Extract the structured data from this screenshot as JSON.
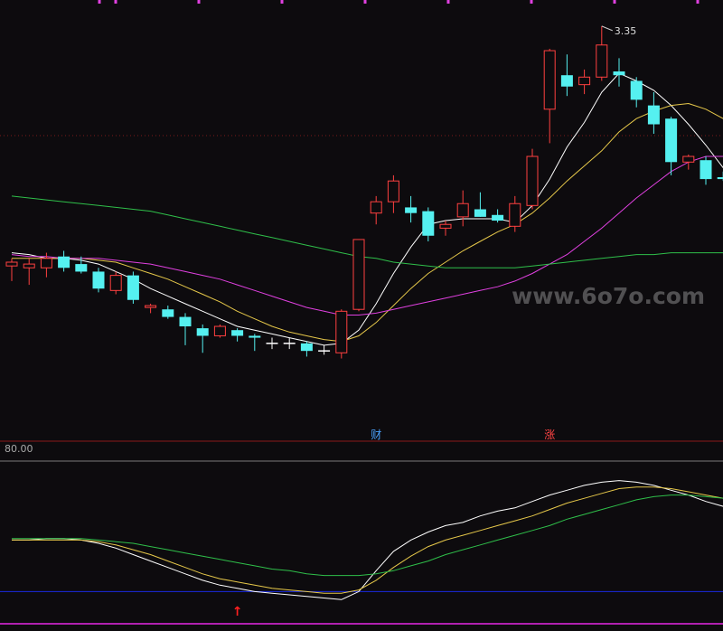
{
  "chart_data": [
    {
      "type": "candlestick",
      "title": "",
      "price_panel_ylim": [
        1.2,
        3.45
      ],
      "max_price_label": "3.35",
      "markers": [
        {
          "text": "财",
          "index": 21,
          "color": "#4aa3ff"
        },
        {
          "text": "涨",
          "index": 31,
          "color": "#ff4444"
        }
      ],
      "candles": [
        {
          "o": 2.08,
          "h": 2.12,
          "l": 2.0,
          "c": 2.1
        },
        {
          "o": 2.07,
          "h": 2.12,
          "l": 1.98,
          "c": 2.09
        },
        {
          "o": 2.07,
          "h": 2.15,
          "l": 2.02,
          "c": 2.12
        },
        {
          "o": 2.13,
          "h": 2.16,
          "l": 2.05,
          "c": 2.07
        },
        {
          "o": 2.09,
          "h": 2.13,
          "l": 2.04,
          "c": 2.05
        },
        {
          "o": 2.05,
          "h": 2.07,
          "l": 1.94,
          "c": 1.96
        },
        {
          "o": 1.95,
          "h": 2.05,
          "l": 1.93,
          "c": 2.03
        },
        {
          "o": 2.03,
          "h": 2.05,
          "l": 1.88,
          "c": 1.9
        },
        {
          "o": 1.86,
          "h": 1.88,
          "l": 1.83,
          "c": 1.87
        },
        {
          "o": 1.85,
          "h": 1.87,
          "l": 1.8,
          "c": 1.81
        },
        {
          "o": 1.81,
          "h": 1.83,
          "l": 1.66,
          "c": 1.76
        },
        {
          "o": 1.75,
          "h": 1.77,
          "l": 1.62,
          "c": 1.71
        },
        {
          "o": 1.71,
          "h": 1.77,
          "l": 1.7,
          "c": 1.76
        },
        {
          "o": 1.74,
          "h": 1.75,
          "l": 1.68,
          "c": 1.71
        },
        {
          "o": 1.71,
          "h": 1.72,
          "l": 1.63,
          "c": 1.7
        },
        {
          "o": 1.67,
          "h": 1.7,
          "l": 1.64,
          "c": 1.67
        },
        {
          "o": 1.67,
          "h": 1.7,
          "l": 1.64,
          "c": 1.67
        },
        {
          "o": 1.67,
          "h": 1.68,
          "l": 1.6,
          "c": 1.63
        },
        {
          "o": 1.63,
          "h": 1.66,
          "l": 1.61,
          "c": 1.63
        },
        {
          "o": 1.62,
          "h": 1.85,
          "l": 1.59,
          "c": 1.84
        },
        {
          "o": 1.85,
          "h": 2.22,
          "l": 1.84,
          "c": 2.22
        },
        {
          "o": 2.36,
          "h": 2.45,
          "l": 2.3,
          "c": 2.42
        },
        {
          "o": 2.42,
          "h": 2.56,
          "l": 2.36,
          "c": 2.53
        },
        {
          "o": 2.39,
          "h": 2.45,
          "l": 2.31,
          "c": 2.36
        },
        {
          "o": 2.37,
          "h": 2.39,
          "l": 2.21,
          "c": 2.24
        },
        {
          "o": 2.28,
          "h": 2.32,
          "l": 2.24,
          "c": 2.3
        },
        {
          "o": 2.34,
          "h": 2.48,
          "l": 2.29,
          "c": 2.41
        },
        {
          "o": 2.38,
          "h": 2.47,
          "l": 2.34,
          "c": 2.34
        },
        {
          "o": 2.35,
          "h": 2.38,
          "l": 2.31,
          "c": 2.32
        },
        {
          "o": 2.29,
          "h": 2.45,
          "l": 2.26,
          "c": 2.41
        },
        {
          "o": 2.4,
          "h": 2.7,
          "l": 2.38,
          "c": 2.66
        },
        {
          "o": 2.91,
          "h": 3.23,
          "l": 2.73,
          "c": 3.22
        },
        {
          "o": 3.09,
          "h": 3.2,
          "l": 2.98,
          "c": 3.03
        },
        {
          "o": 3.04,
          "h": 3.12,
          "l": 2.99,
          "c": 3.08
        },
        {
          "o": 3.08,
          "h": 3.35,
          "l": 3.06,
          "c": 3.25
        },
        {
          "o": 3.11,
          "h": 3.18,
          "l": 3.03,
          "c": 3.09
        },
        {
          "o": 3.06,
          "h": 3.08,
          "l": 2.92,
          "c": 2.96
        },
        {
          "o": 2.93,
          "h": 3.0,
          "l": 2.78,
          "c": 2.83
        },
        {
          "o": 2.86,
          "h": 2.87,
          "l": 2.56,
          "c": 2.63
        },
        {
          "o": 2.63,
          "h": 2.67,
          "l": 2.59,
          "c": 2.66
        },
        {
          "o": 2.64,
          "h": 2.66,
          "l": 2.51,
          "c": 2.54
        },
        {
          "o": 2.55,
          "h": 2.58,
          "l": 2.53,
          "c": 2.54
        },
        {
          "o": 2.49,
          "h": 2.55,
          "l": 2.18,
          "c": 2.2
        }
      ],
      "ma_series": [
        {
          "color": "#ffffff",
          "values": [
            2.15,
            2.14,
            2.12,
            2.12,
            2.11,
            2.09,
            2.05,
            2.01,
            1.96,
            1.92,
            1.88,
            1.84,
            1.8,
            1.76,
            1.74,
            1.72,
            1.7,
            1.68,
            1.66,
            1.67,
            1.74,
            1.88,
            2.04,
            2.18,
            2.3,
            2.32,
            2.33,
            2.33,
            2.33,
            2.31,
            2.4,
            2.54,
            2.71,
            2.84,
            3.0,
            3.1,
            3.06,
            3.01,
            2.93,
            2.83,
            2.72,
            2.6,
            2.5
          ]
        },
        {
          "color": "#e6c84a",
          "values": [
            2.12,
            2.12,
            2.12,
            2.12,
            2.12,
            2.11,
            2.1,
            2.07,
            2.04,
            2.01,
            1.97,
            1.93,
            1.89,
            1.84,
            1.8,
            1.76,
            1.73,
            1.71,
            1.69,
            1.68,
            1.71,
            1.78,
            1.87,
            1.96,
            2.04,
            2.1,
            2.16,
            2.21,
            2.26,
            2.3,
            2.36,
            2.44,
            2.53,
            2.61,
            2.69,
            2.79,
            2.86,
            2.9,
            2.93,
            2.94,
            2.91,
            2.86,
            2.8
          ]
        },
        {
          "color": "#e040e0",
          "values": [
            2.14,
            2.13,
            2.13,
            2.12,
            2.12,
            2.12,
            2.11,
            2.1,
            2.09,
            2.07,
            2.05,
            2.03,
            2.01,
            1.98,
            1.95,
            1.92,
            1.89,
            1.86,
            1.84,
            1.82,
            1.82,
            1.83,
            1.85,
            1.87,
            1.89,
            1.91,
            1.93,
            1.95,
            1.97,
            2.0,
            2.04,
            2.09,
            2.14,
            2.21,
            2.28,
            2.36,
            2.44,
            2.51,
            2.58,
            2.63,
            2.66,
            2.66,
            2.65
          ]
        },
        {
          "color": "#2fbf4a",
          "values": [
            2.45,
            2.44,
            2.43,
            2.42,
            2.41,
            2.4,
            2.39,
            2.38,
            2.37,
            2.35,
            2.33,
            2.31,
            2.29,
            2.27,
            2.25,
            2.23,
            2.21,
            2.19,
            2.17,
            2.15,
            2.13,
            2.12,
            2.1,
            2.09,
            2.08,
            2.07,
            2.07,
            2.07,
            2.07,
            2.07,
            2.08,
            2.09,
            2.1,
            2.11,
            2.12,
            2.13,
            2.14,
            2.14,
            2.15,
            2.15,
            2.15,
            2.15,
            2.15
          ]
        }
      ]
    },
    {
      "type": "line",
      "title": "",
      "ylabel_top": "80.00",
      "ylim": [
        0,
        100
      ],
      "series": [
        {
          "color": "#ffffff",
          "values": [
            52,
            52,
            53,
            53,
            52,
            50,
            47,
            43,
            39,
            35,
            31,
            27,
            24,
            22,
            20,
            19,
            18,
            17,
            16,
            15,
            20,
            33,
            45,
            52,
            57,
            61,
            63,
            67,
            70,
            72,
            76,
            80,
            83,
            86,
            88,
            89,
            88,
            86,
            83,
            80,
            76,
            73,
            71
          ]
        },
        {
          "color": "#e6c84a",
          "values": [
            52,
            52,
            52,
            52,
            52,
            51,
            49,
            46,
            43,
            39,
            35,
            31,
            28,
            26,
            24,
            22,
            21,
            20,
            19,
            19,
            21,
            27,
            35,
            42,
            48,
            52,
            55,
            58,
            61,
            64,
            67,
            71,
            75,
            78,
            81,
            84,
            85,
            85,
            84,
            82,
            80,
            78,
            76
          ]
        },
        {
          "color": "#2fbf4a",
          "values": [
            53,
            53,
            53,
            53,
            53,
            52,
            51,
            50,
            48,
            46,
            44,
            42,
            40,
            38,
            36,
            34,
            33,
            31,
            30,
            30,
            30,
            31,
            33,
            36,
            39,
            43,
            46,
            49,
            52,
            55,
            58,
            61,
            65,
            68,
            71,
            74,
            77,
            79,
            80,
            80,
            79,
            78,
            77
          ]
        }
      ],
      "reference_line": 20,
      "signal": {
        "text": "↑",
        "index": 13,
        "color": "#ff2020"
      }
    }
  ],
  "watermark": "www.6o7o.com"
}
